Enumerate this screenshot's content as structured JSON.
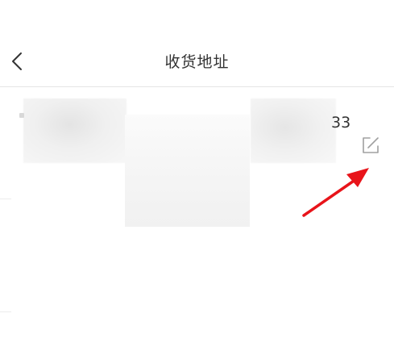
{
  "header": {
    "title": "收货地址"
  },
  "address": {
    "phone_suffix": "33"
  },
  "colors": {
    "text": "#333333",
    "divider": "#e5e5e5",
    "annotation_arrow": "#e8141a",
    "icon": "#a0a0a0"
  },
  "icons": {
    "back": "chevron-left-icon",
    "edit": "edit-icon"
  }
}
